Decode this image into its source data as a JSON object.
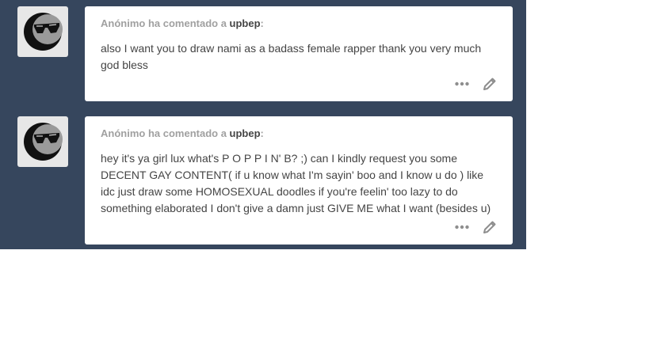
{
  "icons": {
    "avatar": "anonymous-sunglasses-icon",
    "more": "ellipsis-icon",
    "edit": "pencil-icon"
  },
  "colors": {
    "dashboard_bg": "#36465d",
    "card_bg": "#ffffff",
    "asker_text": "#a0a0a0",
    "body_text": "#444444",
    "icon": "#8e8e8e"
  },
  "posts": [
    {
      "asker": "Anónimo",
      "verb": "ha comentado a",
      "blog": "upbep",
      "question": "also I want you to draw nami as a badass female rapper thank you very much god bless"
    },
    {
      "asker": "Anónimo",
      "verb": "ha comentado a",
      "blog": "upbep",
      "question": "hey it's ya girl lux what's P O P P I N' B? ;) can I kindly request you some DECENT GAY CONTENT( if u know what I'm sayin' boo and I know u do ) like idc just draw some HOMOSEXUAL doodles if you're feelin' too lazy to do something elaborated I don't give a damn just GIVE ME what I want (besides u)"
    }
  ]
}
